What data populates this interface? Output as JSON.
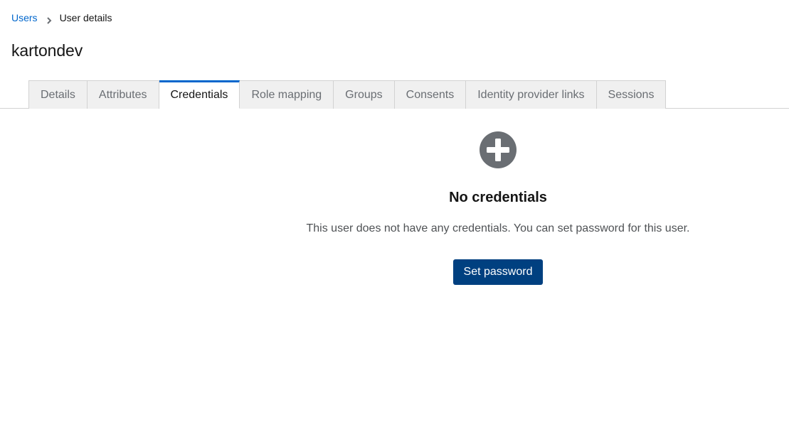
{
  "breadcrumb": {
    "parent_label": "Users",
    "current_label": "User details",
    "separator_icon": "chevron-right-icon"
  },
  "page": {
    "title": "kartondev"
  },
  "tabs": [
    {
      "label": "Details",
      "active": false
    },
    {
      "label": "Attributes",
      "active": false
    },
    {
      "label": "Credentials",
      "active": true
    },
    {
      "label": "Role mapping",
      "active": false
    },
    {
      "label": "Groups",
      "active": false
    },
    {
      "label": "Consents",
      "active": false
    },
    {
      "label": "Identity provider links",
      "active": false
    },
    {
      "label": "Sessions",
      "active": false
    }
  ],
  "empty_state": {
    "icon": "plus-circle-icon",
    "title": "No credentials",
    "body": "This user does not have any credentials. You can set password for this user.",
    "action_label": "Set password"
  },
  "colors": {
    "link": "#0066cc",
    "active_tab_border": "#0066cc",
    "primary_button": "#004080",
    "icon_gray": "#6a6e73"
  }
}
